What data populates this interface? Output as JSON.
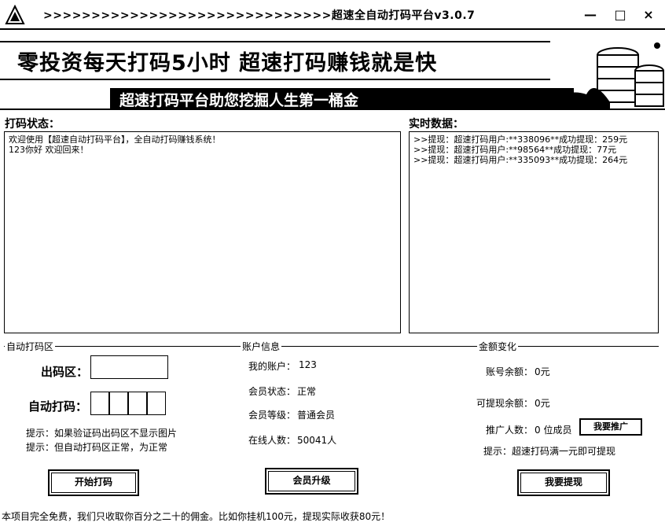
{
  "window": {
    "title": ">>>>>>>>>>>>>>>>>>>>>>>>>>>>>>超速全自动打码平台v3.0.7",
    "minimize": "—",
    "maximize": "□",
    "close": "×"
  },
  "banner": {
    "slogan": "零投资每天打码5小时  超速打码赚钱就是快",
    "subslogan": "超速打码平台助您挖掘人生第一桶金"
  },
  "status_panel": {
    "label": "打码状态：",
    "lines": [
      "欢迎使用【超速自动打码平台】，全自动打码赚钱系统！",
      "123你好 欢迎回来！"
    ]
  },
  "realtime_panel": {
    "label": "实时数据：",
    "lines": [
      ">>提现：超速打码用户:**338096**成功提现：259元",
      ">>提现：超速打码用户:**98564**成功提现：77元",
      ">>提现：超速打码用户:**335093**成功提现：264元"
    ]
  },
  "auto_section": {
    "title": "自动打码区",
    "output_label": "出码区：",
    "auto_label": "自动打码：",
    "hint1": "提示：如果验证码出码区不显示图片",
    "hint2": "提示：但自动打码区正常，为正常",
    "button": "开始打码"
  },
  "account_section": {
    "title": "账户信息",
    "account_label": "我的账户：",
    "account_value": "123",
    "status_label": "会员状态：",
    "status_value": "正常",
    "level_label": "会员等级：",
    "level_value": "普通会员",
    "online_label": "在线人数：",
    "online_value": "50041人",
    "button": "会员升级"
  },
  "balance_section": {
    "title": "金额变化",
    "balance_label": "账号余额：",
    "balance_value": "0元",
    "withdrawable_label": "可提现余额：",
    "withdrawable_value": "0元",
    "promo_label": "推广人数：",
    "promo_value": "0 位成员",
    "promo_button": "我要推广",
    "hint": "提示：超速打码满一元即可提现",
    "button": "我要提现"
  },
  "footer": {
    "text": "本项目完全免费，我们只收取你百分之二十的佣金。比如你挂机100元，提现实际收获80元！"
  }
}
